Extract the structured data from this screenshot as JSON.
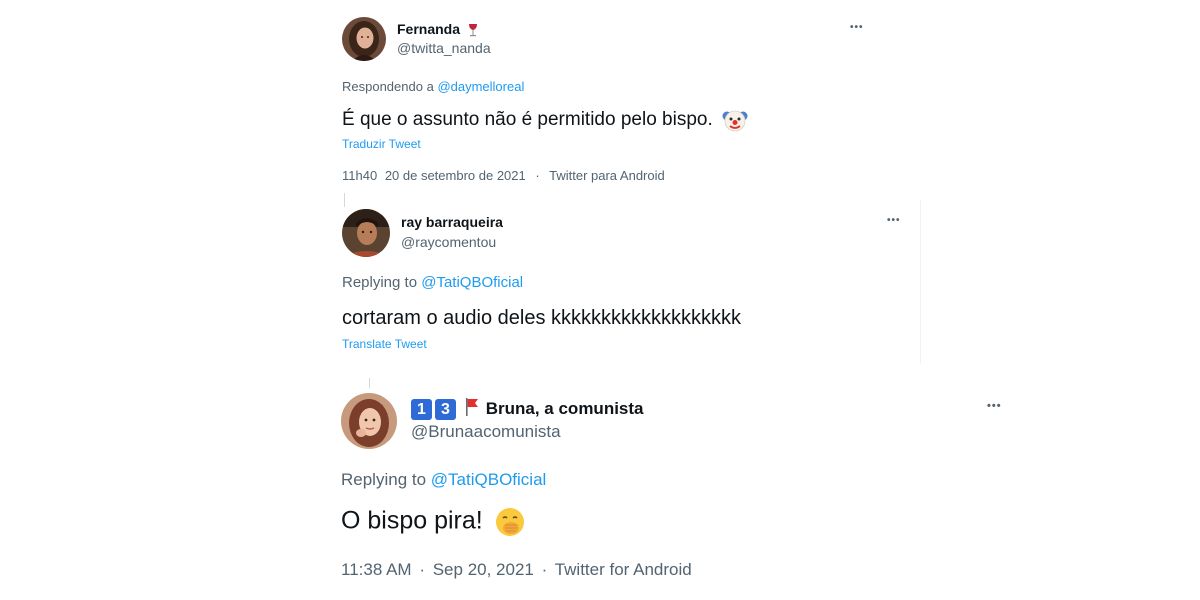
{
  "tweets": [
    {
      "display_name": "Fernanda",
      "name_emoji": "wine-glass-icon",
      "handle": "@twitta_nanda",
      "more_label": "•••",
      "reply_prefix": "Respondendo a",
      "reply_to": "@daymelloreal",
      "text": "É que o assunto não é permitido pelo bispo.",
      "text_emoji": "clown-face-icon",
      "translate_label": "Traduzir Tweet",
      "time": "11h40",
      "date": "20 de setembro de 2021",
      "sep": "·",
      "source": "Twitter para Android"
    },
    {
      "display_name": "ray barraqueira",
      "handle": "@raycomentou",
      "more_label": "•••",
      "reply_prefix": "Replying to",
      "reply_to": "@TatiQBOficial",
      "text": "cortaram o audio deles kkkkkkkkkkkkkkkkkkk",
      "translate_label": "Translate Tweet"
    },
    {
      "badge_1": "1",
      "badge_2": "3",
      "name_flag": "red-flag-icon",
      "display_name": "Bruna, a comunista",
      "handle": "@Brunaacomunista",
      "more_label": "•••",
      "reply_prefix": "Replying to",
      "reply_to": "@TatiQBOficial",
      "text": "O bispo pira!",
      "text_emoji": "hand-over-mouth-icon",
      "time": "11:38 AM",
      "sep1": "·",
      "date": "Sep 20, 2021",
      "sep2": "·",
      "source": "Twitter for Android"
    }
  ],
  "colors": {
    "link": "#1d9bf0",
    "secondary_text": "#536471",
    "primary_text": "#0f1419"
  }
}
